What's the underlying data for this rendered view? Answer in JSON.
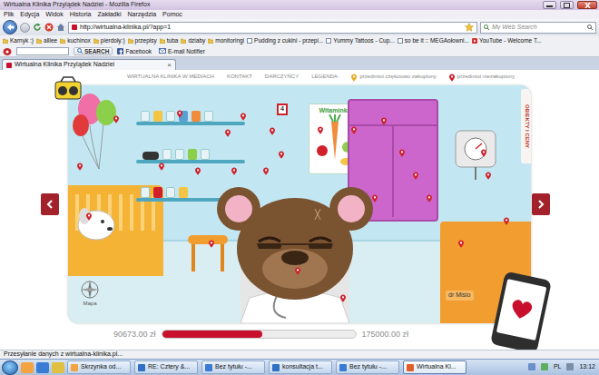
{
  "window": {
    "title": "Wirtualna Klinika Przylądek Nadziei - Mozilla Firefox"
  },
  "menu": [
    "Plik",
    "Edycja",
    "Widok",
    "Historia",
    "Zakładki",
    "Narzędzia",
    "Pomoc"
  ],
  "address": {
    "url": "http://wirtualna-klinika.pl/?app=1"
  },
  "search": {
    "placeholder": "My Web Search"
  },
  "bookmarks": [
    {
      "label": "Karnyk :)",
      "kind": "folder"
    },
    {
      "label": "alllee",
      "kind": "folder"
    },
    {
      "label": "kuchinox",
      "kind": "folder"
    },
    {
      "label": "pierdoły:)",
      "kind": "folder"
    },
    {
      "label": "przepisy",
      "kind": "folder"
    },
    {
      "label": "tuba",
      "kind": "folder"
    },
    {
      "label": "dziaby",
      "kind": "folder"
    },
    {
      "label": "monitoringi",
      "kind": "folder"
    },
    {
      "label": "Pudding z cukini - przepi...",
      "kind": "page"
    },
    {
      "label": "Yummy Tattoos - Cup...",
      "kind": "page"
    },
    {
      "label": "so be it :: MEGAołowni...",
      "kind": "page"
    },
    {
      "label": "YouTube - Welcome T...",
      "kind": "youtube"
    }
  ],
  "toolbar": {
    "search_button": "SEARCH",
    "links": [
      "Facebook",
      "E-mail Notifier"
    ]
  },
  "tabs": [
    {
      "label": "Wirtualna Klinika Przylądek Nadziei",
      "close": "×",
      "selected": true
    }
  ],
  "page": {
    "nav": [
      "WIRTUALNA KLINIKA W MEDIACH",
      "KONTAKT",
      "DARCZYŃCY"
    ],
    "legend": {
      "label": "LEGENDA:",
      "items": [
        {
          "label": "przedmiot częściowo zakupiony",
          "color": "#e8a820"
        },
        {
          "label": "przedmiot niezakupiony",
          "color": "#d0202a"
        }
      ]
    },
    "scene": {
      "poster": "Witaminki",
      "box_number": "4",
      "nameplate": "dr Misio",
      "side_tab": "OBIEKTY I CENY",
      "map_label": "Mapa",
      "pins": [
        {
          "kind": "unpurchased"
        },
        {
          "kind": "unpurchased"
        },
        {
          "kind": "unpurchased"
        },
        {
          "kind": "unpurchased"
        },
        {
          "kind": "unpurchased"
        },
        {
          "kind": "unpurchased"
        },
        {
          "kind": "unpurchased"
        },
        {
          "kind": "unpurchased"
        },
        {
          "kind": "unpurchased"
        },
        {
          "kind": "unpurchased"
        },
        {
          "kind": "unpurchased"
        },
        {
          "kind": "unpurchased"
        },
        {
          "kind": "unpurchased"
        },
        {
          "kind": "unpurchased"
        },
        {
          "kind": "unpurchased"
        },
        {
          "kind": "unpurchased"
        },
        {
          "kind": "unpurchased"
        },
        {
          "kind": "unpurchased"
        },
        {
          "kind": "unpurchased"
        },
        {
          "kind": "unpurchased"
        },
        {
          "kind": "unpurchased"
        },
        {
          "kind": "unpurchased"
        },
        {
          "kind": "unpurchased"
        },
        {
          "kind": "unpurchased"
        },
        {
          "kind": "unpurchased"
        },
        {
          "kind": "unpurchased"
        }
      ]
    },
    "fundraiser": {
      "raised": "90673.00 zł",
      "goal": "175000.00 zł",
      "level": 0.518
    }
  },
  "status_bar": "Przesyłanie danych z wirtualna-klinika.pl...",
  "taskbar": {
    "items": [
      {
        "label": "Skrzynka od...",
        "selected": false
      },
      {
        "label": "RE: Cztery &...",
        "selected": false
      },
      {
        "label": "Bez tytułu -...",
        "selected": false
      },
      {
        "label": "konsultacja t...",
        "selected": false
      },
      {
        "label": "Bez tytułu -...",
        "selected": false
      },
      {
        "label": "Wirtualna Kl...",
        "selected": true
      }
    ],
    "language": "PL",
    "time": "13:12"
  }
}
